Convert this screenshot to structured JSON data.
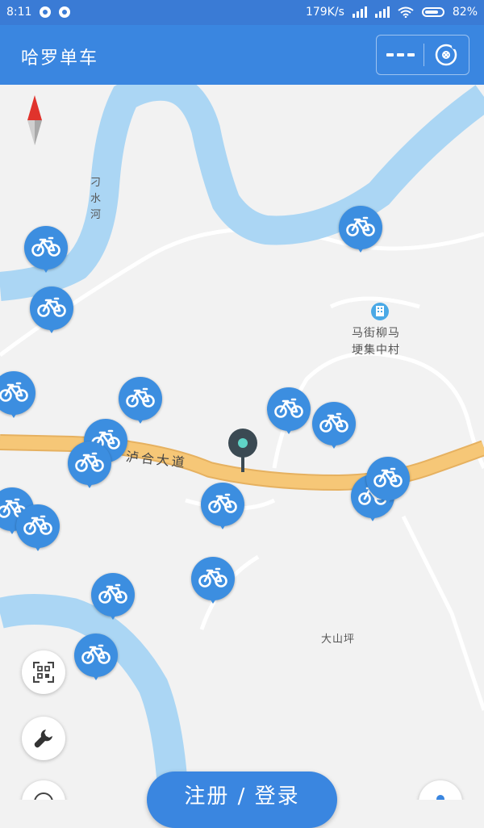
{
  "status_bar": {
    "time": "8:11",
    "net_speed": "179K/s",
    "battery": "82%"
  },
  "app": {
    "title": "哈罗单车",
    "more_icon": "more-dots-icon",
    "close_icon": "close-circle-icon"
  },
  "map": {
    "labels": {
      "river": "刁水河",
      "road": "泸合大道",
      "village_1": "马街柳马",
      "village_2": "埂集中村",
      "place": "大山坪"
    },
    "bike_icon": "bicycle-icon",
    "bike_count": 19
  },
  "controls": {
    "scan_icon": "scan-qr-icon",
    "repair_icon": "wrench-icon",
    "main_button_label": "注册 / 登录"
  },
  "colors": {
    "brand": "#3a86e0",
    "water": "#abd6f4",
    "road": "#f6c777",
    "pin": "#3c8ee0"
  }
}
